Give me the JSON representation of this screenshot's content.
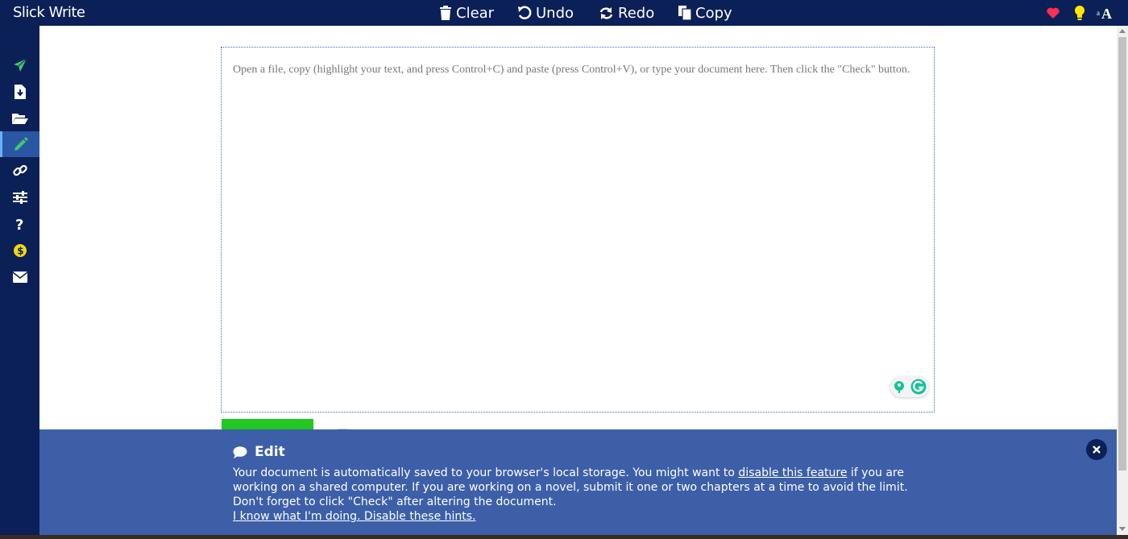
{
  "app": {
    "title": "Slick Write"
  },
  "toolbar": {
    "clear_label": "Clear",
    "undo_label": "Undo",
    "redo_label": "Redo",
    "copy_label": "Copy"
  },
  "top_right_icons": [
    "heart-icon",
    "lightbulb-icon",
    "font-size-icon"
  ],
  "sidebar": {
    "items": [
      {
        "icon": "paper-plane-icon"
      },
      {
        "icon": "download-file-icon"
      },
      {
        "icon": "folder-open-icon"
      },
      {
        "icon": "pencil-icon",
        "active": true
      },
      {
        "icon": "link-icon"
      },
      {
        "icon": "sliders-icon"
      },
      {
        "icon": "question-icon"
      },
      {
        "icon": "dollar-coin-icon"
      },
      {
        "icon": "envelope-icon"
      }
    ]
  },
  "editor": {
    "placeholder": "Open a file, copy (highlight your text, and press Control+C) and paste (press Control+V), or type your document here. Then click the \"Check\" button."
  },
  "hint": {
    "title": "Edit",
    "body_part1": "Your document is automatically saved to your browser's local storage. You might want to ",
    "link_disable_feature": "disable this feature",
    "body_part2": " if you are working on a shared computer. If you are working on a novel, submit it one or two chapters at a time to avoid the limit. Don't forget to click \"Check\" after altering the document.",
    "link_disable_hints": "I know what I'm doing. Disable these hints."
  },
  "colors": {
    "topbar": "#0b2057",
    "hint_bg": "#3c5fa8",
    "check_button": "#22c722",
    "accent_green": "#3ec96a",
    "coin": "#f5d90a",
    "heart": "#ff2d55",
    "bulb": "#ffe600"
  }
}
